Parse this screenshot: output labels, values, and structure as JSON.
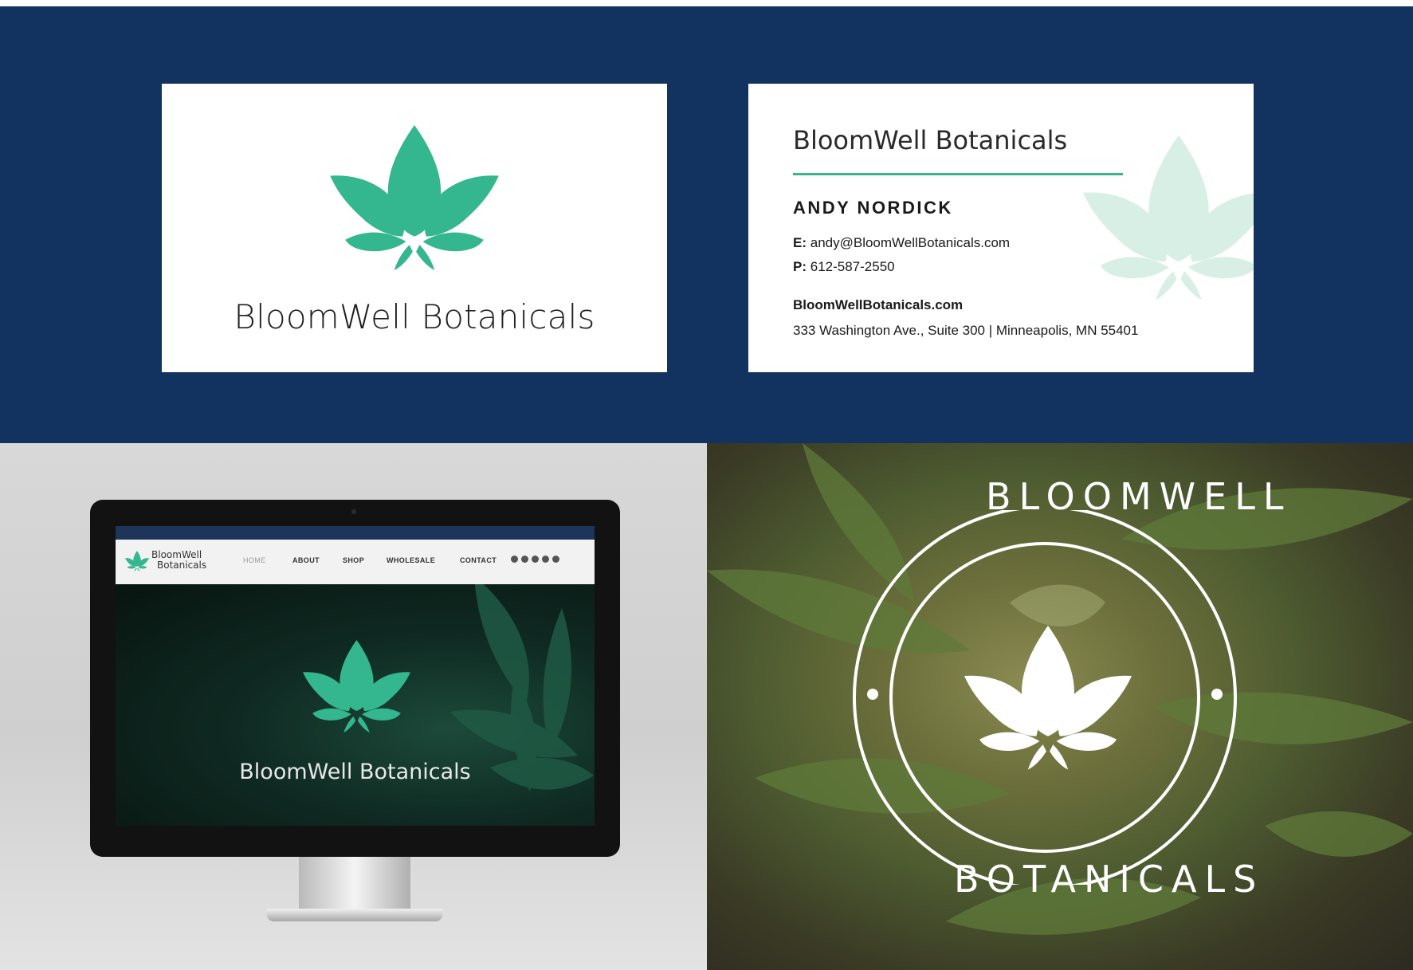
{
  "colors": {
    "navy": "#12335f",
    "brand_green": "#34b68e",
    "pale_green": "#d7efe5",
    "white": "#ffffff"
  },
  "card_front": {
    "brand": "BloomWell Botanicals",
    "logo": "cannabis-leaf-icon"
  },
  "card_back": {
    "brand": "BloomWell Botanicals",
    "person": "ANDY NORDICK",
    "email_label": "E:",
    "email": "andy@BloomWellBotanicals.com",
    "phone_label": "P:",
    "phone": "612-587-2550",
    "website": "BloomWellBotanicals.com",
    "address": "333 Washington Ave., Suite 300 | Minneapolis, MN 55401",
    "watermark": "cannabis-leaf-icon"
  },
  "website_mockup": {
    "nav_brand_line1": "BloomWell",
    "nav_brand_line2": "Botanicals",
    "nav_items": [
      "HOME",
      "ABOUT",
      "SHOP",
      "WHOLESALE",
      "CONTACT"
    ],
    "social_icons": [
      "instagram-icon",
      "youtube-icon",
      "twitter-icon",
      "facebook-icon",
      "google-plus-icon"
    ],
    "hero_brand": "BloomWell Botanicals"
  },
  "badge": {
    "top_text": "BLOOMWELL",
    "bottom_text": "BOTANICALS"
  }
}
